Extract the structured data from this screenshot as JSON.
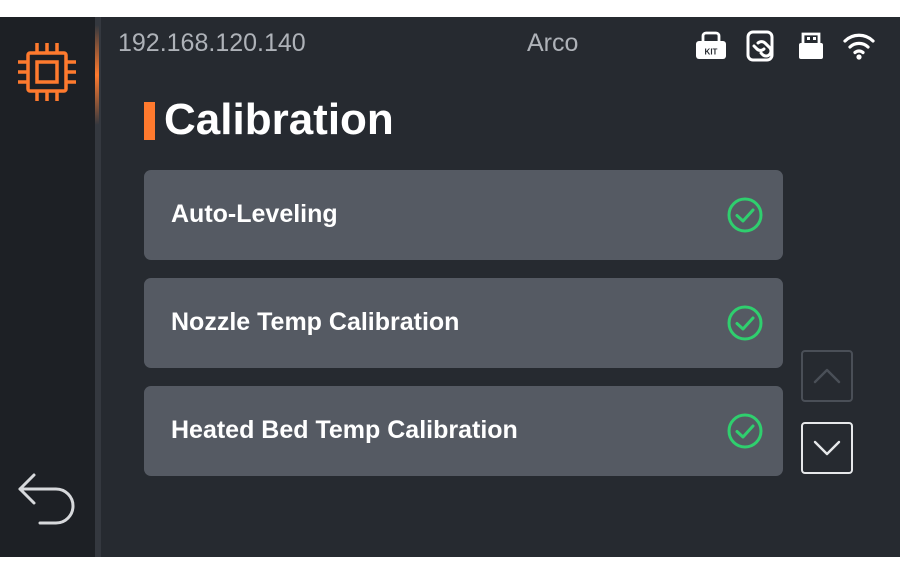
{
  "status_bar": {
    "ip_address": "192.168.120.140",
    "device_name": "Arco",
    "icons": [
      "kit-printer-icon",
      "nfc-link-icon",
      "usb-drive-icon",
      "wifi-icon"
    ],
    "kit_label": "KIT"
  },
  "sidebar": {
    "top_icon": "chip-icon",
    "bottom_icon": "back-arrow-icon"
  },
  "page": {
    "title": "Calibration"
  },
  "calibration_items": [
    {
      "label": "Auto-Leveling",
      "status_icon": "check-circle-icon"
    },
    {
      "label": "Nozzle Temp Calibration",
      "status_icon": "check-circle-icon"
    },
    {
      "label": "Heated Bed Temp Calibration",
      "status_icon": "check-circle-icon"
    }
  ],
  "colors": {
    "accent": "#ff7a2e",
    "success": "#2fcf6e",
    "item_background": "#555a63",
    "screen_background": "#262a30"
  }
}
